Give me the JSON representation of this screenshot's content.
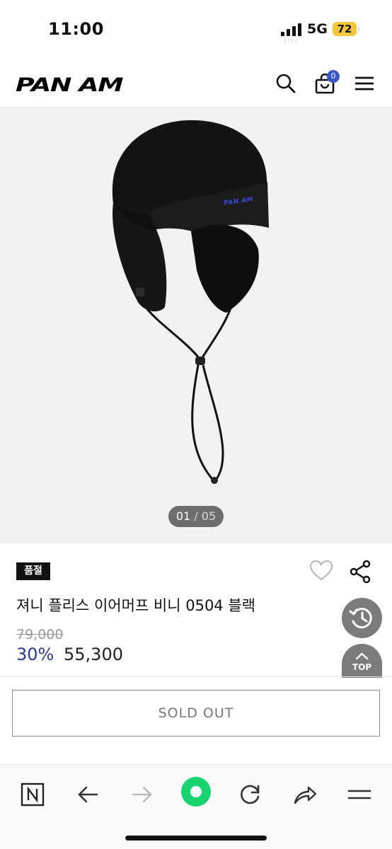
{
  "status_bar": {
    "time": "11:00",
    "network": "5G",
    "battery": "72"
  },
  "header": {
    "logo": "PAN AM",
    "cart_count": "0",
    "icons": [
      "search-icon",
      "cart-icon",
      "menu-icon"
    ]
  },
  "gallery": {
    "current": "01",
    "separator": "/",
    "total": "05",
    "image_logo_text": "PAN AM"
  },
  "product": {
    "badge": "품절",
    "title": "져니 플리스 이어머프 비니 0504 블랙",
    "original_price": "79,000",
    "discount": "30%",
    "price": "55,300"
  },
  "floating": {
    "top_label": "TOP"
  },
  "actions": {
    "sold_out_label": "SOLD OUT"
  },
  "browser_bar": {
    "icons": [
      "naver-icon",
      "back-icon",
      "forward-icon",
      "green-dot-icon",
      "refresh-icon",
      "share-arrow-icon",
      "menu-icon"
    ]
  },
  "colors": {
    "discount": "#2b3a8f",
    "cart_badge": "#3a56c9",
    "battery": "#f5c83b",
    "accent_green": "#19d46e"
  }
}
